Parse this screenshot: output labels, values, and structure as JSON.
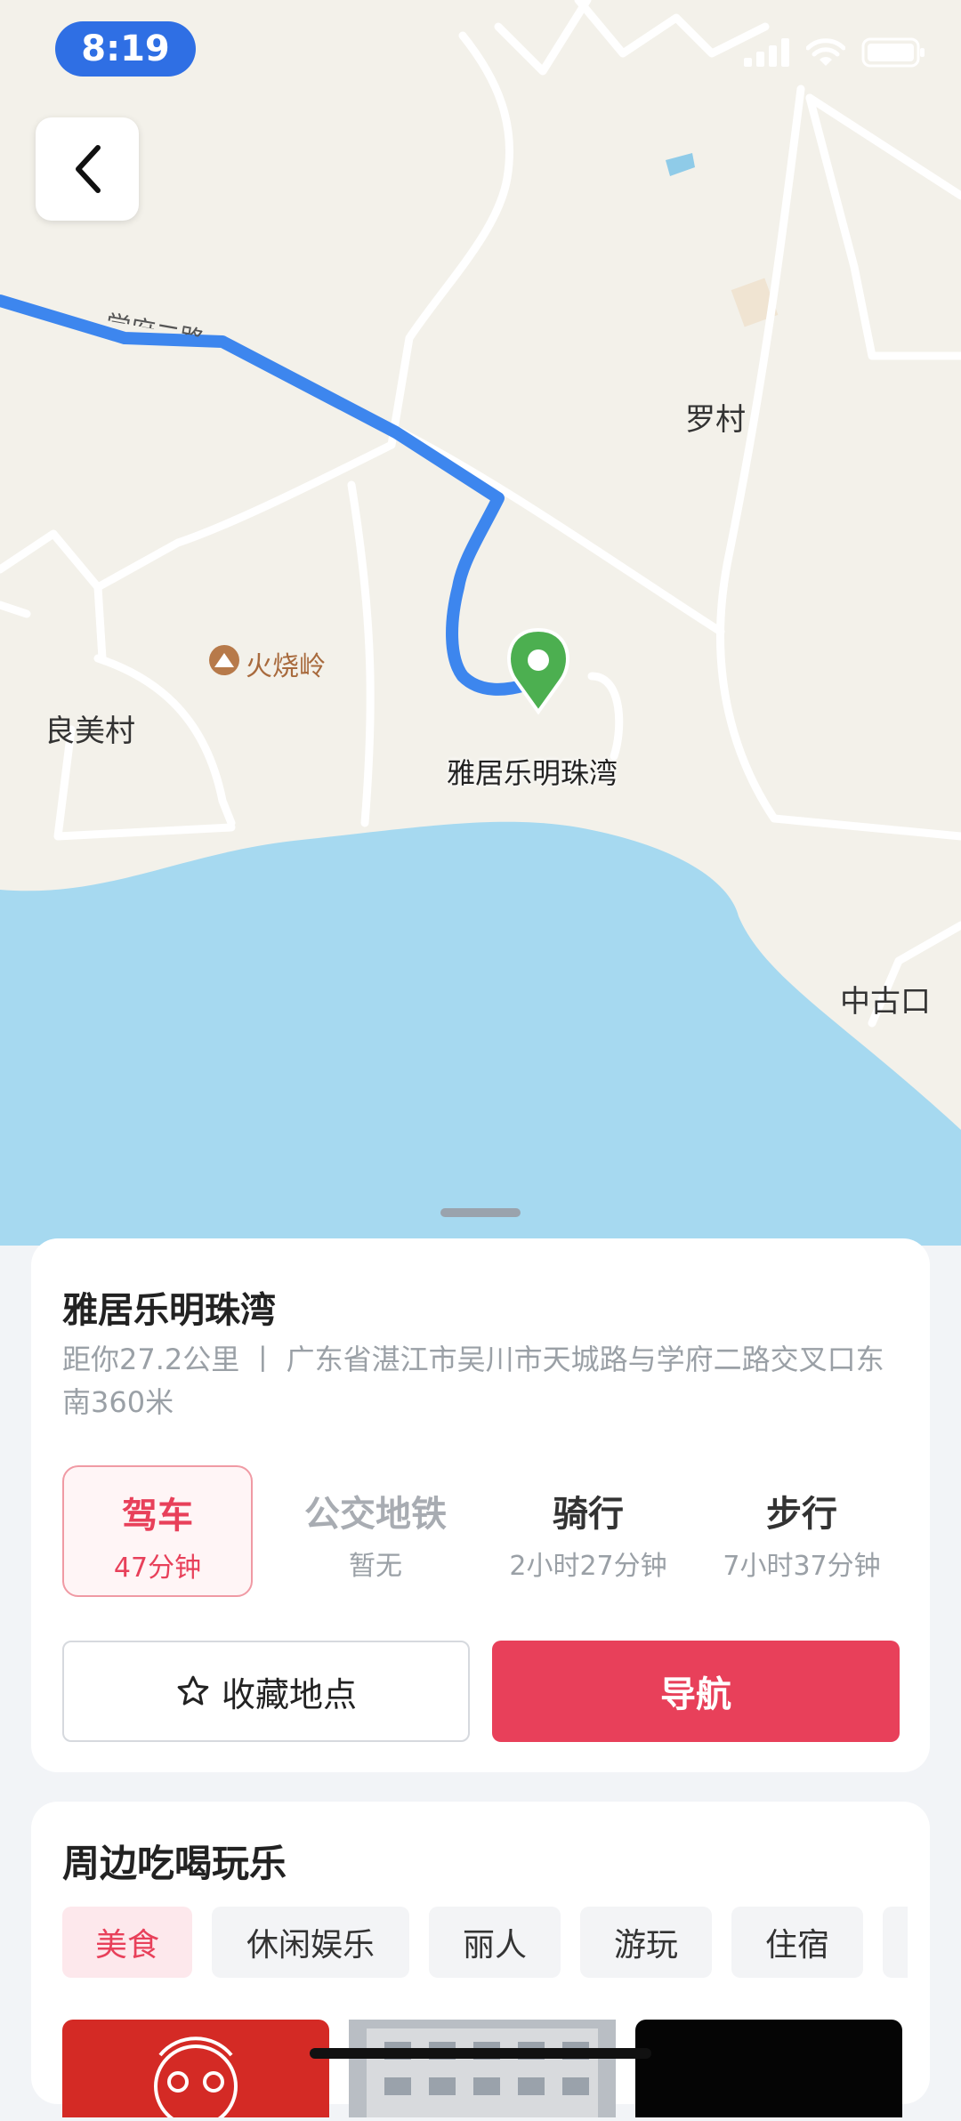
{
  "status_bar": {
    "time": "8:19"
  },
  "map": {
    "labels": {
      "road_fragment": "学府二路",
      "luo_village": "罗村",
      "huoshaoling": "火烧岭",
      "liangmei_village": "良美村",
      "destination": "雅居乐明珠湾",
      "zhonggukou": "中古口"
    },
    "colors": {
      "land": "#f3f1ea",
      "water": "#a6d9f0",
      "route": "#3d86ee",
      "pin": "#4caf50"
    }
  },
  "place": {
    "name": "雅居乐明珠湾",
    "address": "距你27.2公里 丨 广东省湛江市吴川市天城路与学府二路交叉口东南360米"
  },
  "travel_modes": [
    {
      "label": "驾车",
      "time": "47分钟"
    },
    {
      "label": "公交地铁",
      "time": "暂无"
    },
    {
      "label": "骑行",
      "time": "2小时27分钟"
    },
    {
      "label": "步行",
      "time": "7小时37分钟"
    }
  ],
  "actions": {
    "favorite": "收藏地点",
    "navigate": "导航"
  },
  "nearby": {
    "title": "周边吃喝玩乐",
    "categories": [
      "美食",
      "休闲娱乐",
      "丽人",
      "游玩",
      "住宿"
    ]
  },
  "accent_color": "#e8405a"
}
